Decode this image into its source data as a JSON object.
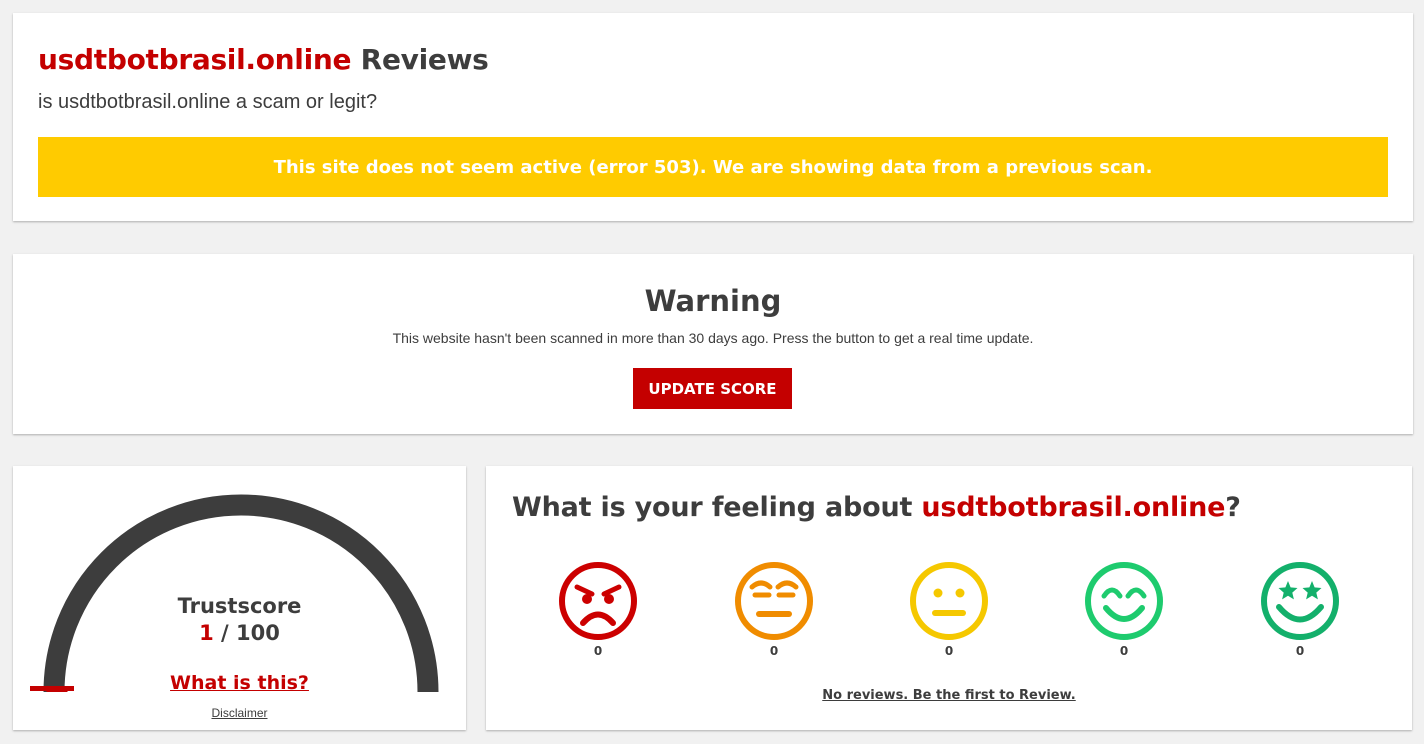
{
  "header": {
    "domain": "usdtbotbrasil.online",
    "title_suffix": " Reviews",
    "subtitle": "is usdtbotbrasil.online a scam or legit?",
    "alert": "This site does not seem active (error 503). We are showing data from a previous scan."
  },
  "warning": {
    "title": "Warning",
    "text": "This website hasn't been scanned in more than 30 days ago. Press the button to get a real time update.",
    "button_label": "UPDATE SCORE"
  },
  "trustscore": {
    "label": "Trustscore",
    "value": "1",
    "separator": " / ",
    "max": "100",
    "score_fraction": 0.01,
    "what_link": "What is this?",
    "disclaimer": "Disclaimer"
  },
  "feeling": {
    "title_prefix": "What is your feeling about ",
    "domain": "usdtbotbrasil.online",
    "title_suffix": "?",
    "faces": [
      {
        "icon": "angry-face-icon",
        "color": "#cc0000",
        "count": "0"
      },
      {
        "icon": "annoyed-face-icon",
        "color": "#f08c00",
        "count": "0"
      },
      {
        "icon": "neutral-face-icon",
        "color": "#f5c800",
        "count": "0"
      },
      {
        "icon": "smiling-face-icon",
        "color": "#1ecb6e",
        "count": "0"
      },
      {
        "icon": "star-struck-face-icon",
        "color": "#13b06b",
        "count": "0"
      }
    ],
    "no_reviews": "No reviews. Be the first to Review."
  },
  "colors": {
    "accent_red": "#c40000",
    "alert_yellow": "#ffcb00",
    "gauge_dark": "#3d3d3d"
  }
}
